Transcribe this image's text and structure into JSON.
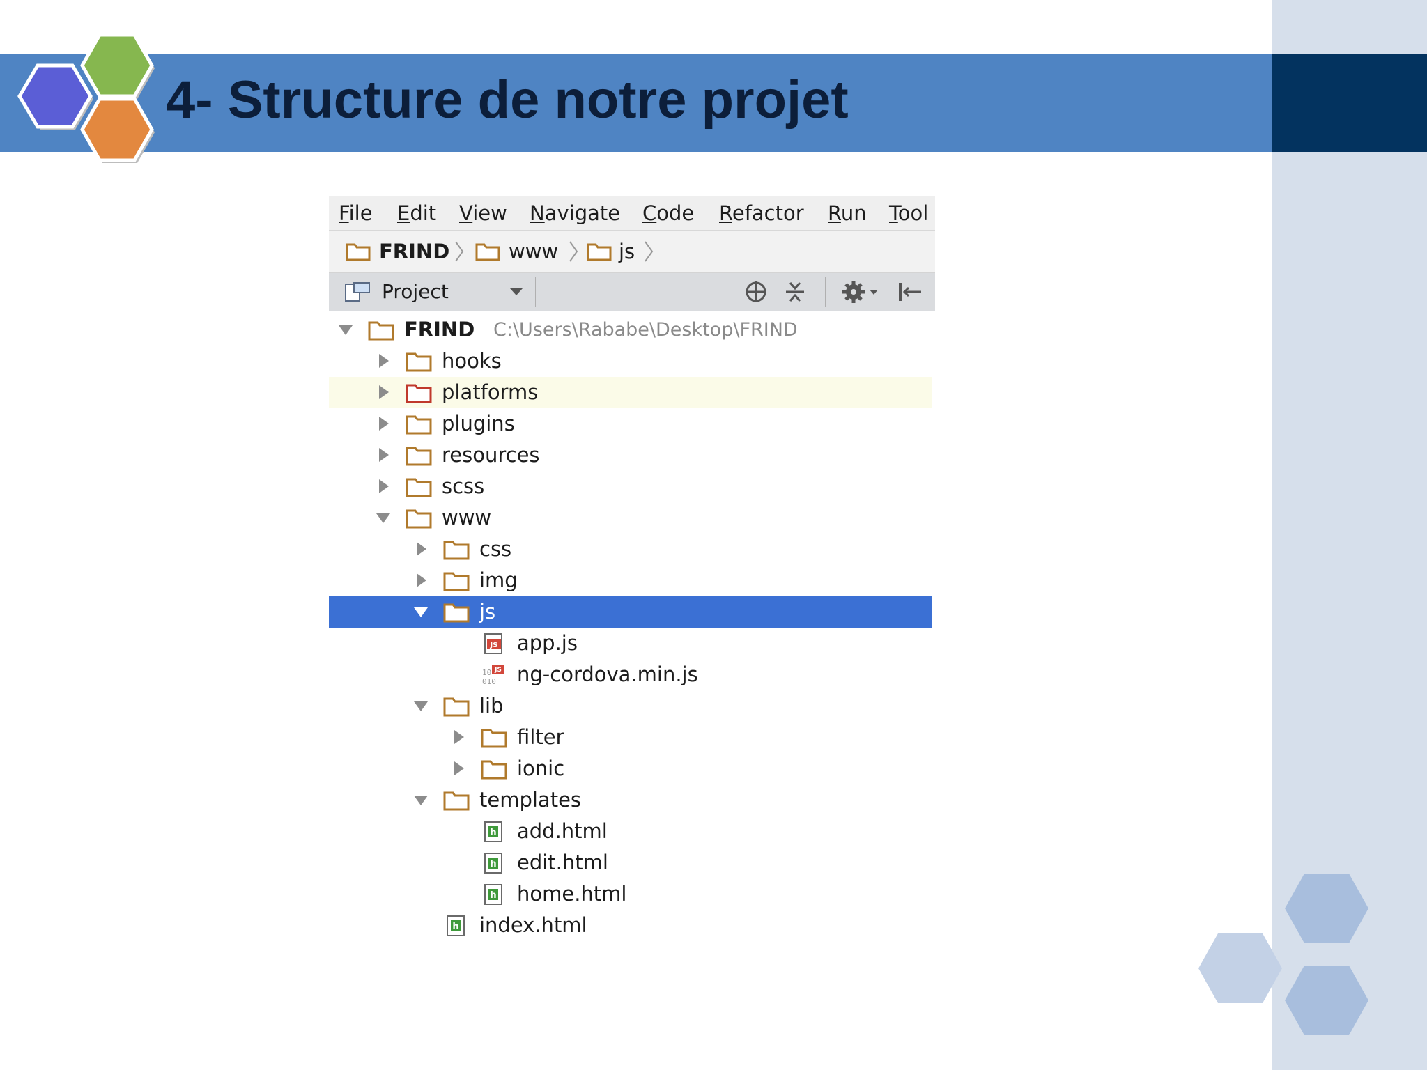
{
  "slide": {
    "title": "4- Structure de notre projet",
    "colors": {
      "band": "#4f84c3",
      "band_dark": "#03335f",
      "side_panel": "#d6dfeb",
      "title_text": "#0c1e3a"
    }
  },
  "ide": {
    "menu": [
      "File",
      "Edit",
      "View",
      "Navigate",
      "Code",
      "Refactor",
      "Run",
      "Tool"
    ],
    "breadcrumb": [
      "FRIND",
      "www",
      "js"
    ],
    "toolbar": {
      "view_label": "Project",
      "icons": [
        "project-view-icon",
        "dropdown-arrow-icon",
        "locate-icon",
        "collapse-all-icon",
        "settings-gear-icon",
        "hide-panel-icon"
      ]
    },
    "tree": [
      {
        "label": "FRIND",
        "path": "C:\\Users\\Rababe\\Desktop\\FRIND",
        "kind": "folder",
        "expanded": true,
        "bold": true
      },
      {
        "label": "hooks",
        "kind": "folder",
        "expanded": false
      },
      {
        "label": "platforms",
        "kind": "folder",
        "expanded": false,
        "highlighted": true
      },
      {
        "label": "plugins",
        "kind": "folder",
        "expanded": false
      },
      {
        "label": "resources",
        "kind": "folder",
        "expanded": false
      },
      {
        "label": "scss",
        "kind": "folder",
        "expanded": false
      },
      {
        "label": "www",
        "kind": "folder",
        "expanded": true
      },
      {
        "label": "css",
        "kind": "folder",
        "expanded": false
      },
      {
        "label": "img",
        "kind": "folder",
        "expanded": false
      },
      {
        "label": "js",
        "kind": "folder",
        "expanded": true,
        "selected": true
      },
      {
        "label": "app.js",
        "kind": "js-file"
      },
      {
        "label": "ng-cordova.min.js",
        "kind": "minjs-file"
      },
      {
        "label": "lib",
        "kind": "folder",
        "expanded": true
      },
      {
        "label": "filter",
        "kind": "folder",
        "expanded": false
      },
      {
        "label": "ionic",
        "kind": "folder",
        "expanded": false
      },
      {
        "label": "templates",
        "kind": "folder",
        "expanded": true
      },
      {
        "label": "add.html",
        "kind": "html-file"
      },
      {
        "label": "edit.html",
        "kind": "html-file"
      },
      {
        "label": "home.html",
        "kind": "html-file"
      },
      {
        "label": "index.html",
        "kind": "html-file"
      }
    ],
    "colors": {
      "selection": "#3b70d4",
      "highlight_row": "#fbfbe8",
      "folder": "#b07a2c",
      "folder_special": "#c0392b",
      "html_icon": "#3f9a3b",
      "js_icon": "#d2473b"
    }
  }
}
